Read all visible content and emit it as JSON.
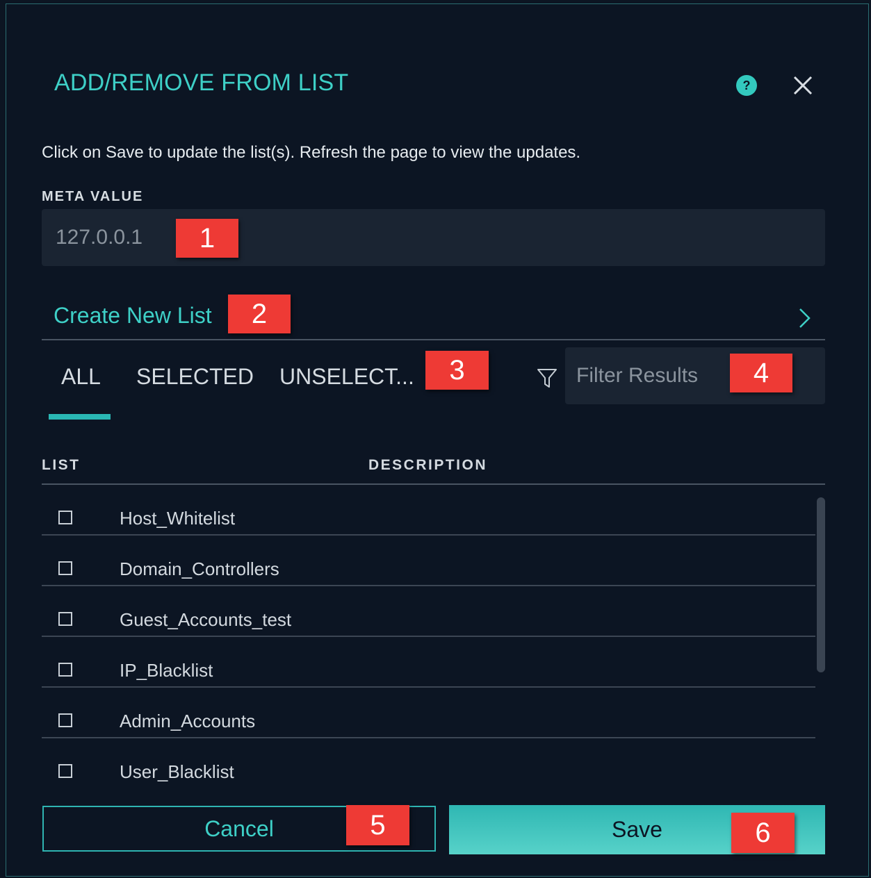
{
  "dialog": {
    "title": "ADD/REMOVE FROM LIST",
    "instruction": "Click on Save to update the list(s). Refresh the page to view the updates."
  },
  "meta": {
    "label": "META VALUE",
    "value": "127.0.0.1"
  },
  "create_list": {
    "label": "Create New List"
  },
  "tabs": [
    {
      "label": "ALL",
      "active": true
    },
    {
      "label": "SELECTED",
      "active": false
    },
    {
      "label": "UNSELECT...",
      "active": false
    }
  ],
  "filter": {
    "placeholder": "Filter Results"
  },
  "table": {
    "columns": [
      "LIST",
      "DESCRIPTION"
    ],
    "rows": [
      {
        "name": "Host_Whitelist",
        "checked": false
      },
      {
        "name": "Domain_Controllers",
        "checked": false
      },
      {
        "name": "Guest_Accounts_test",
        "checked": false
      },
      {
        "name": "IP_Blacklist",
        "checked": false
      },
      {
        "name": "Admin_Accounts",
        "checked": false
      },
      {
        "name": "User_Blacklist",
        "checked": false
      }
    ]
  },
  "buttons": {
    "cancel": "Cancel",
    "save": "Save"
  },
  "annotations": [
    "1",
    "2",
    "3",
    "4",
    "5",
    "6"
  ],
  "colors": {
    "accent": "#3ed0c7",
    "background": "#0c1523",
    "input_bg": "#1a2432",
    "badge": "#ee3a35"
  },
  "icons": {
    "help": "help-icon",
    "close": "close-icon",
    "chevron": "chevron-right-icon",
    "filter": "filter-icon"
  }
}
